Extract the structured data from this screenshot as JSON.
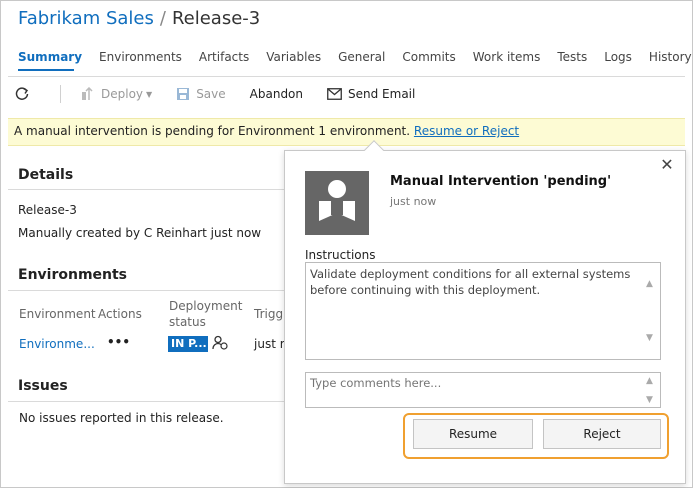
{
  "header": {
    "project": "Fabrikam Sales",
    "separator": "/",
    "release": "Release-3"
  },
  "tabs": [
    {
      "label": "Summary",
      "active": true
    },
    {
      "label": "Environments"
    },
    {
      "label": "Artifacts"
    },
    {
      "label": "Variables"
    },
    {
      "label": "General"
    },
    {
      "label": "Commits"
    },
    {
      "label": "Work items"
    },
    {
      "label": "Tests"
    },
    {
      "label": "Logs"
    },
    {
      "label": "History"
    }
  ],
  "toolbar": {
    "refresh_icon": "refresh-icon",
    "deploy_label": "Deploy",
    "save_label": "Save",
    "abandon_label": "Abandon",
    "send_email_label": "Send Email"
  },
  "banner": {
    "message": "A manual intervention is pending for Environment 1 environment.",
    "link": "Resume or Reject"
  },
  "details": {
    "title": "Details",
    "release": "Release-3",
    "created": "Manually created by  C  Reinhart   just now"
  },
  "environments": {
    "title": "Environments",
    "col_environment": "Environment",
    "col_actions": "Actions",
    "col_status_1": "Deployment",
    "col_status_2": "status",
    "col_trigger": "Trigg",
    "row": {
      "environment": "Environme...",
      "actions": "•••",
      "status": "IN P...",
      "trigger": "just r"
    }
  },
  "issues": {
    "title": "Issues",
    "message": "No issues reported in this release."
  },
  "popup": {
    "title": "Manual Intervention 'pending'",
    "subtitle": "just now",
    "instructions_label": "Instructions",
    "instructions": "Validate deployment conditions for all external systems before continuing with this deployment.",
    "comments_placeholder": "Type comments here...",
    "resume_label": "Resume",
    "reject_label": "Reject",
    "close_glyph": "✕"
  },
  "colors": {
    "accent": "#106ebe",
    "banner_bg": "#fdfbd4",
    "highlight": "#f0a030"
  }
}
